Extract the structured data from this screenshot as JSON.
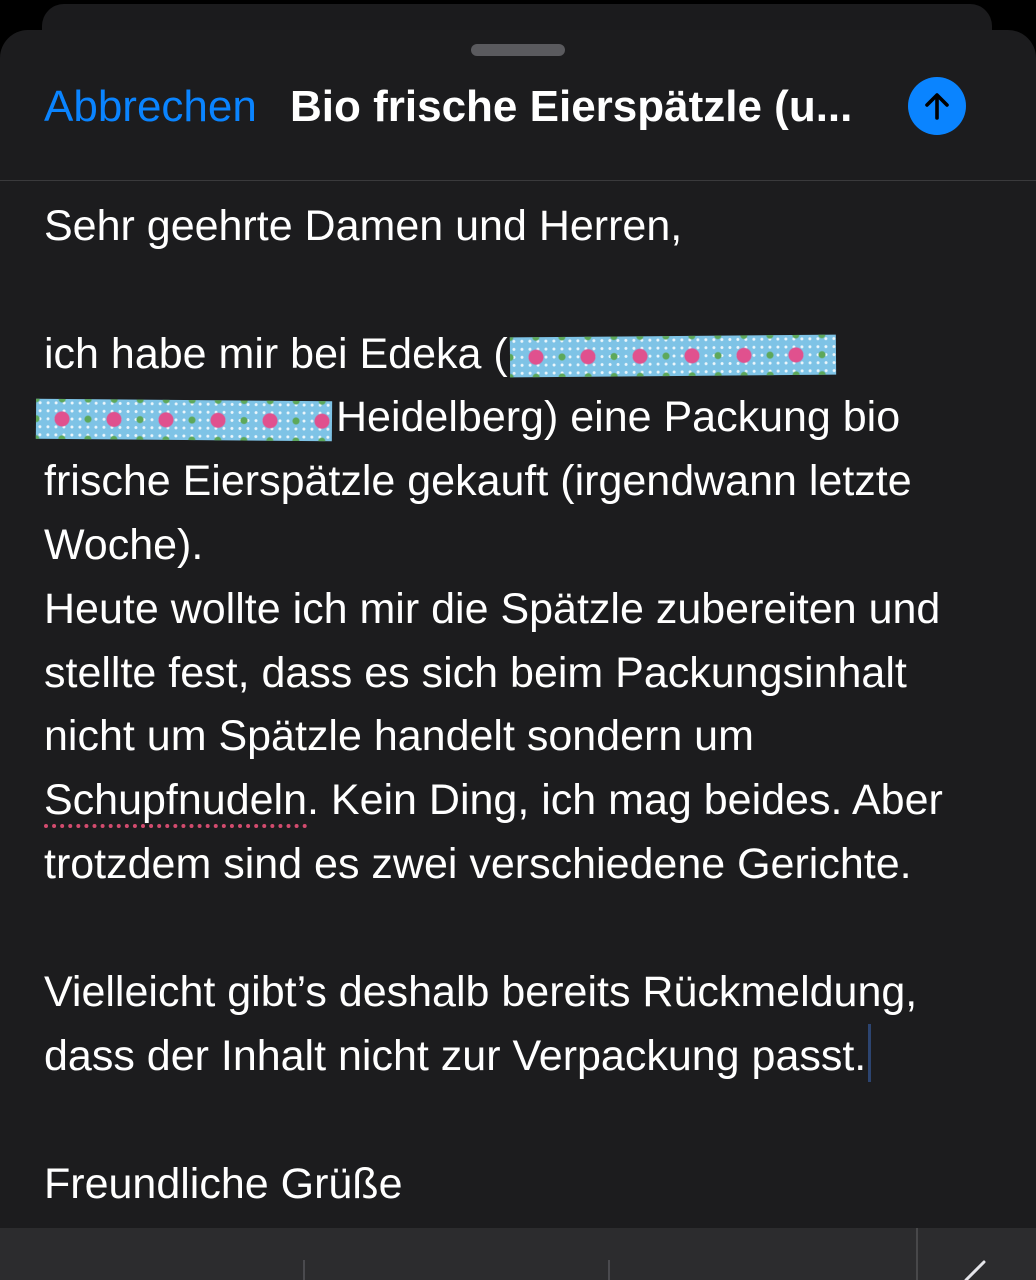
{
  "compose": {
    "cancel_label": "Abbrechen",
    "subject": "Bio frische Eierspätzle (u...",
    "send_icon": "arrow-up-icon",
    "accent_color": "#0a84ff"
  },
  "body": {
    "line1": "Sehr geehrte Damen und Herren,",
    "line2_a": "ich habe mir bei Edeka (",
    "line3_b": "Heidelberg) eine Packung bio",
    "line4": "frische Eierspätzle gekauft (irgendwann letzte",
    "line5": "Woche).",
    "line6": "Heute wollte ich mir die Spätzle zubereiten und",
    "line7": "stellte fest, dass es sich beim Packungsinhalt",
    "line8": "nicht um Spätzle handelt sondern um",
    "line9_misspelled": "Schupfnudeln",
    "line9_rest": ". Kein Ding, ich mag beides. Aber",
    "line10": "trotzdem sind es zwei verschiedene Gerichte.",
    "line11": "Vielleicht gibt’s deshalb bereits Rückmeldung,",
    "line12": "dass der Inhalt nicht zur Verpackung passt.",
    "line13": "Freundliche Grüße"
  }
}
